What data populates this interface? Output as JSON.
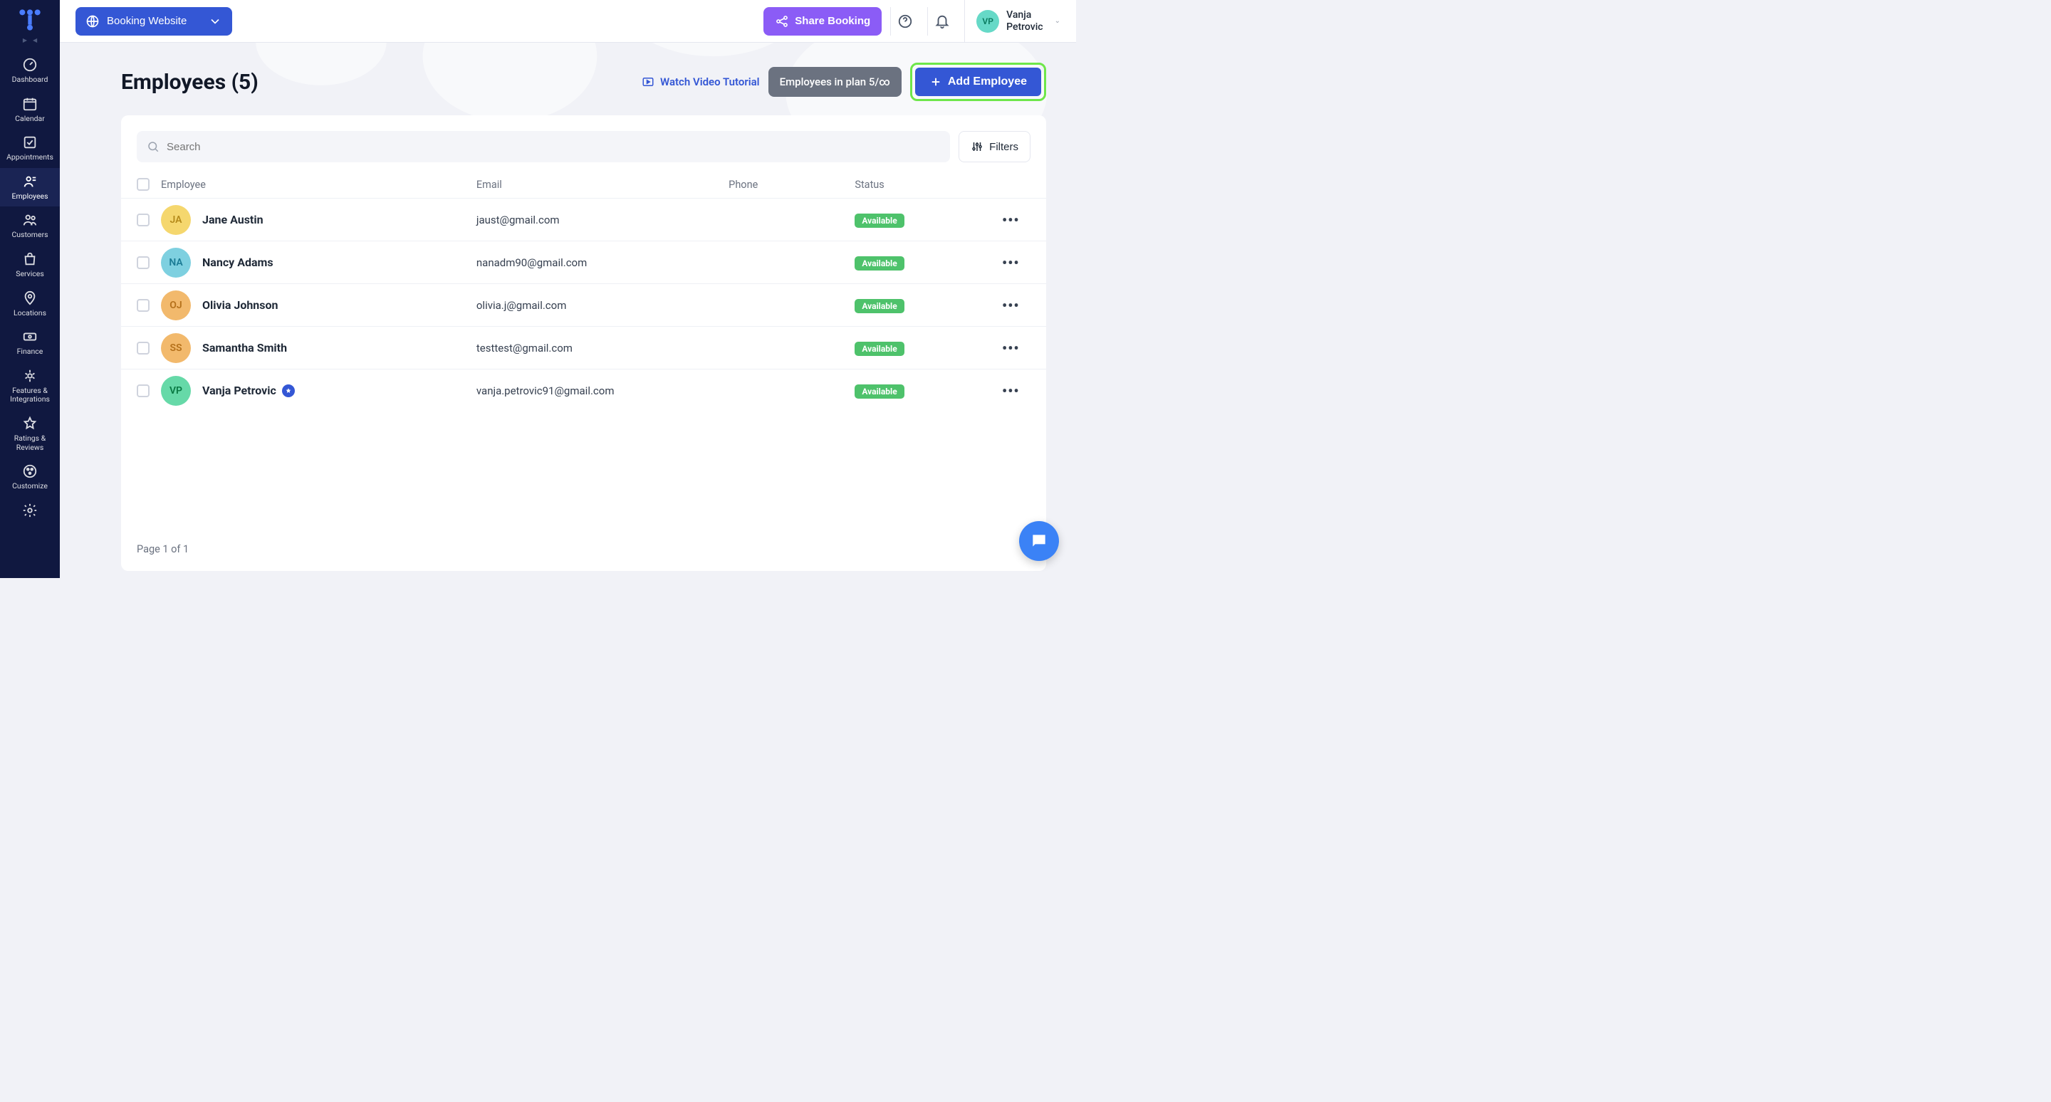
{
  "topbar": {
    "booking_label": "Booking Website",
    "share_label": "Share Booking",
    "user_initials": "VP",
    "user_firstname": "Vanja",
    "user_lastname": "Petrovic"
  },
  "sidebar": {
    "items": [
      {
        "label": "Dashboard"
      },
      {
        "label": "Calendar"
      },
      {
        "label": "Appointments"
      },
      {
        "label": "Employees"
      },
      {
        "label": "Customers"
      },
      {
        "label": "Services"
      },
      {
        "label": "Locations"
      },
      {
        "label": "Finance"
      },
      {
        "label": "Features & Integrations"
      },
      {
        "label": "Ratings & Reviews"
      },
      {
        "label": "Customize"
      }
    ]
  },
  "page": {
    "title": "Employees (5)",
    "watch_label": "Watch Video Tutorial",
    "plan_label": "Employees in plan 5/∞",
    "add_label": "Add Employee",
    "search_placeholder": "Search",
    "filters_label": "Filters",
    "columns": {
      "employee": "Employee",
      "email": "Email",
      "phone": "Phone",
      "status": "Status"
    },
    "pager": "Page 1 of 1"
  },
  "status_label": "Available",
  "employees": [
    {
      "initials": "JA",
      "name": "Jane Austin",
      "email": "jaust@gmail.com",
      "avatar_bg": "#f5d76e",
      "avatar_fg": "#b58b1b",
      "starred": false
    },
    {
      "initials": "NA",
      "name": "Nancy Adams",
      "email": "nanadm90@gmail.com",
      "avatar_bg": "#7ed0e0",
      "avatar_fg": "#1b7b95",
      "starred": false
    },
    {
      "initials": "OJ",
      "name": "Olivia Johnson",
      "email": "olivia.j@gmail.com",
      "avatar_bg": "#f2b96c",
      "avatar_fg": "#b5711b",
      "starred": false
    },
    {
      "initials": "SS",
      "name": "Samantha Smith",
      "email": "testtest@gmail.com",
      "avatar_bg": "#f2b96c",
      "avatar_fg": "#b5711b",
      "starred": false
    },
    {
      "initials": "VP",
      "name": "Vanja Petrovic",
      "email": "vanja.petrovic91@gmail.com",
      "avatar_bg": "#66d9a8",
      "avatar_fg": "#0a7a44",
      "starred": true
    }
  ]
}
